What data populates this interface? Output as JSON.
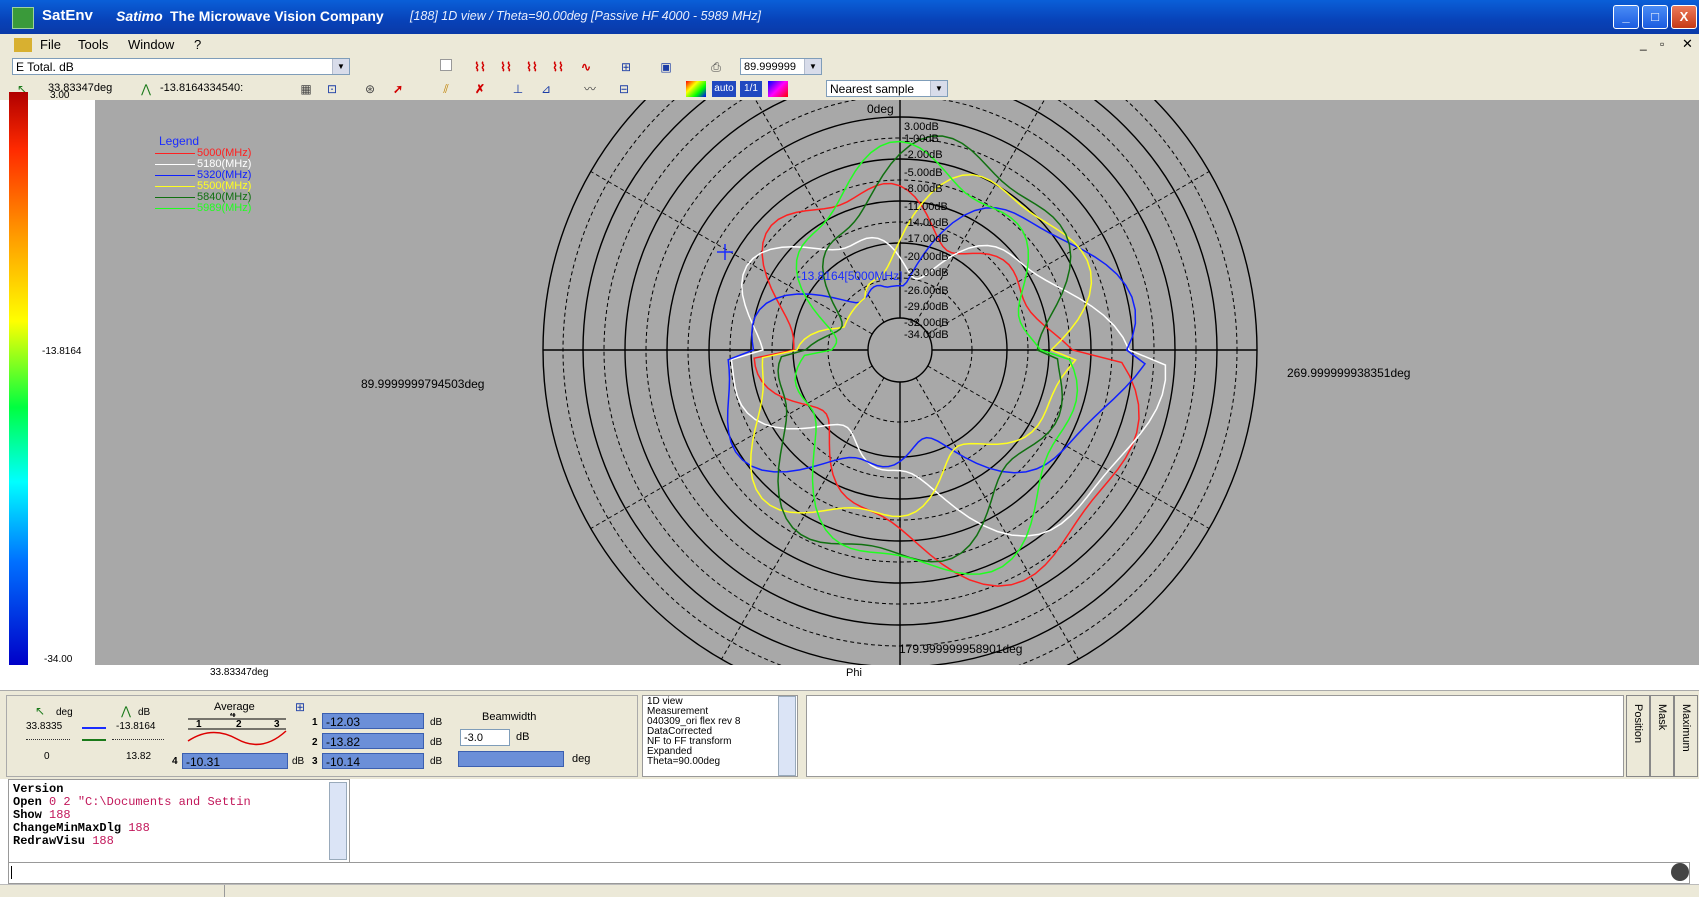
{
  "window": {
    "app_name": "SatEnv",
    "company_brand": "Satimo",
    "company_rest": "The Microwave Vision Company",
    "subtitle": "[188] 1D view / Theta=90.00deg [Passive HF 4000 - 5989 MHz]",
    "min_label": "_",
    "max_label": "□",
    "close_label": "X"
  },
  "menu": [
    "File",
    "Tools",
    "Window",
    "?"
  ],
  "toolbar": {
    "component_select": "E Total. dB",
    "value_combo": "89.999999",
    "phi_readout": "33.83347deg",
    "value_readout": "-13.8164334540:",
    "interp_select": "Nearest sample",
    "btn_auto": "auto",
    "btn_ratio": "1/1"
  },
  "colorbar": {
    "top": "3.00",
    "mid": "-13.8164",
    "bottom": "-34.00",
    "unit": "dB"
  },
  "plot": {
    "axis_top": "0deg",
    "axis_left": "89.9999999794503deg",
    "axis_right": "269.999999938351deg",
    "axis_bottom": "179.999999958901deg",
    "below_left": "33.83347deg",
    "below_center": "Phi",
    "marker_label": "-13.8164[5000MHz]",
    "ring_labels": [
      "3.00dB",
      "1.00dB",
      "-2.00dB",
      "-5.00dB",
      "-8.00dB",
      "-11.00dB",
      "-14.00dB",
      "-17.00dB",
      "-20.00dB",
      "-23.00dB",
      "-26.00dB",
      "-29.00dB",
      "-32.00dB",
      "-34.00dB"
    ],
    "legend_title": "Legend",
    "legend": [
      {
        "label": "5000(MHz)",
        "color": "#ff2020"
      },
      {
        "label": "5180(MHz)",
        "color": "#ffffff"
      },
      {
        "label": "5320(MHz)",
        "color": "#1020ff"
      },
      {
        "label": "5500(MHz)",
        "color": "#ffff20"
      },
      {
        "label": "5840(MHz)",
        "color": "#107010"
      },
      {
        "label": "5989(MHz)",
        "color": "#20ff20"
      }
    ]
  },
  "bottom": {
    "deg_label": "deg",
    "db_label": "dB",
    "row1_deg": "33.8335",
    "row1_db": "-13.8164",
    "row2_deg": "0",
    "row2_db": "13.82",
    "average_label": "Average",
    "field1": "-12.03",
    "field2": "-13.82",
    "field3": "-10.14",
    "field4": "-10.31",
    "idx1": "1",
    "idx2": "2",
    "idx3": "3",
    "idx4": "4",
    "unit": "dB",
    "beamwidth_label": "Beamwidth",
    "beamwidth_value": "-3.0",
    "beamwidth_unit": "dB",
    "deg_unit": "deg",
    "info_lines": [
      "1D view",
      "Measurement",
      "040309_ori flex rev 8",
      "DataCorrected",
      "NF to FF transform",
      "Expanded",
      "Theta=90.00deg"
    ],
    "tabs": [
      "Position",
      "Mask",
      "Maximum"
    ]
  },
  "console": [
    {
      "cmd": "Version",
      "arg": ""
    },
    {
      "cmd": "Open",
      "arg": "0 2 \"C:\\Documents and Settin"
    },
    {
      "cmd": "Show",
      "arg": "188"
    },
    {
      "cmd": "ChangeMinMaxDlg",
      "arg": "188"
    },
    {
      "cmd": "RedrawVisu",
      "arg": "188"
    }
  ]
}
